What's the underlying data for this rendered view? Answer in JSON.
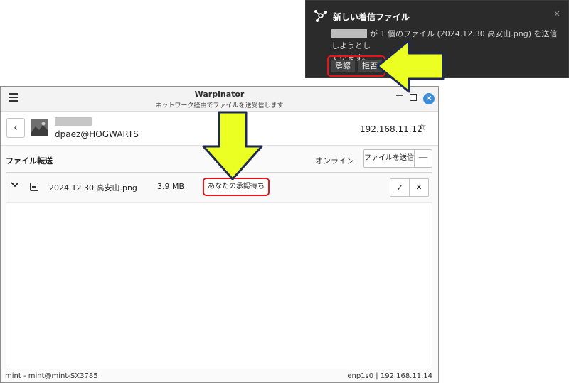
{
  "notification": {
    "title": "新しい着信ファイル",
    "close_glyph": "×",
    "body_line1": "が 1 個のファイル (2024.12.30 高安山.png) を送信しようとし",
    "body_line2": "ています。",
    "accept_label": "承認",
    "reject_label": "拒否",
    "icon": "share-nodes-icon"
  },
  "window": {
    "title": "Warpinator",
    "subtitle": "ネットワーク経由でファイルを送受信します",
    "close_glyph": "✕"
  },
  "user": {
    "id": "dpaez@HOGWARTS",
    "ip": "192.168.11.12"
  },
  "transfers": {
    "section_label": "ファイル転送",
    "status": "オンライン",
    "send_button": "ファイルを送信",
    "more_button": "—",
    "items": [
      {
        "name": "2024.12.30 高安山.png",
        "size": "3.9 MB",
        "status": "あなたの承認待ち"
      }
    ]
  },
  "statusbar": {
    "left": "mint - mint@mint-SX3785",
    "right": "enp1s0  |  192.168.11.14"
  },
  "colors": {
    "highlight": "#e8141c",
    "arrow_fill": "#ecff22",
    "arrow_stroke": "#1e2a55",
    "close_button": "#3a8ddb"
  }
}
